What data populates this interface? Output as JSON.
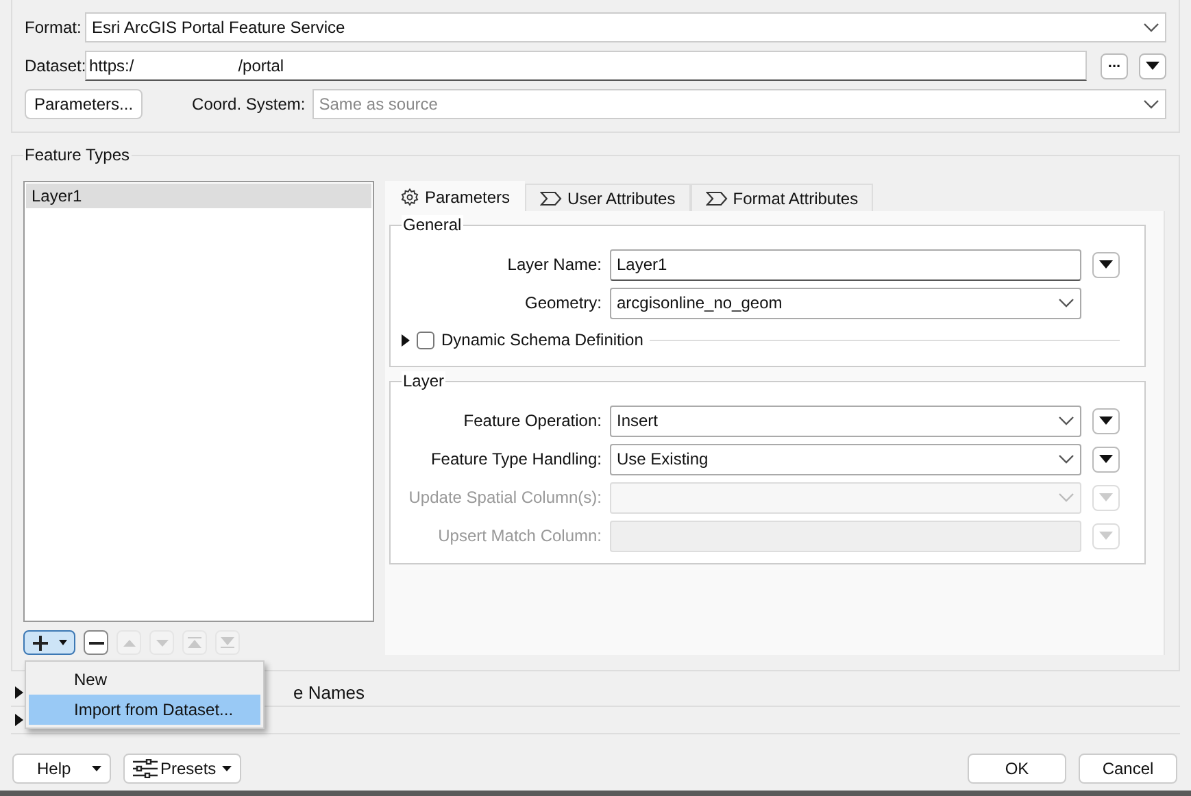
{
  "format": {
    "label": "Format:",
    "value": "Esri ArcGIS Portal Feature Service"
  },
  "dataset": {
    "label": "Dataset:",
    "value_start": "https:/",
    "value_end": "/portal",
    "browse": "..."
  },
  "parameters_button": "Parameters...",
  "coord_system": {
    "label": "Coord. System:",
    "placeholder": "Same as source"
  },
  "feature_types": {
    "title": "Feature Types",
    "layers": [
      {
        "name": "Layer1",
        "selected": true
      }
    ],
    "toolbar": [
      {
        "kind": "add",
        "disabled": false,
        "pressed": true
      },
      {
        "kind": "remove",
        "disabled": false,
        "pressed": false
      },
      {
        "kind": "up",
        "disabled": true,
        "pressed": false
      },
      {
        "kind": "down",
        "disabled": true,
        "pressed": false
      },
      {
        "kind": "top",
        "disabled": true,
        "pressed": false
      },
      {
        "kind": "bottom",
        "disabled": true,
        "pressed": false
      }
    ]
  },
  "tabs": [
    {
      "label": "Parameters",
      "kind": "settings",
      "selected": true
    },
    {
      "label": "User Attributes",
      "kind": "attributes",
      "selected": false
    },
    {
      "label": "Format Attributes",
      "kind": "attributes",
      "selected": false
    }
  ],
  "general": {
    "title": "General",
    "fields": [
      {
        "kind": "text",
        "label": "Layer Name:",
        "value": "Layer1",
        "disabled": false,
        "menu": true
      },
      {
        "kind": "select",
        "label": "Geometry:",
        "value": "arcgisonline_no_geom",
        "disabled": false,
        "menu": false
      }
    ],
    "dynamic_schema": {
      "label": "Dynamic Schema Definition",
      "checked": false,
      "expanded": false
    }
  },
  "layer": {
    "title": "Layer",
    "fields": [
      {
        "kind": "select",
        "label": "Feature Operation:",
        "value": "Insert",
        "disabled": false,
        "menu": true
      },
      {
        "kind": "select",
        "label": "Feature Type Handling:",
        "value": "Use Existing",
        "disabled": false,
        "menu": true
      },
      {
        "kind": "select",
        "label": "Update Spatial Column(s):",
        "disabled": true,
        "menu": true
      },
      {
        "kind": "text",
        "label": "Upsert Match Column:",
        "disabled": true,
        "menu": true
      }
    ]
  },
  "sections": [
    {
      "title": "e Names",
      "expanded": false
    },
    {
      "expanded": false
    }
  ],
  "add_menu": {
    "items": [
      {
        "label": "New",
        "selected": false
      },
      {
        "label": "Import from Dataset...",
        "selected": true
      }
    ]
  },
  "footer": {
    "help": "Help",
    "presets": "Presets",
    "ok": "OK",
    "cancel": "Cancel"
  }
}
